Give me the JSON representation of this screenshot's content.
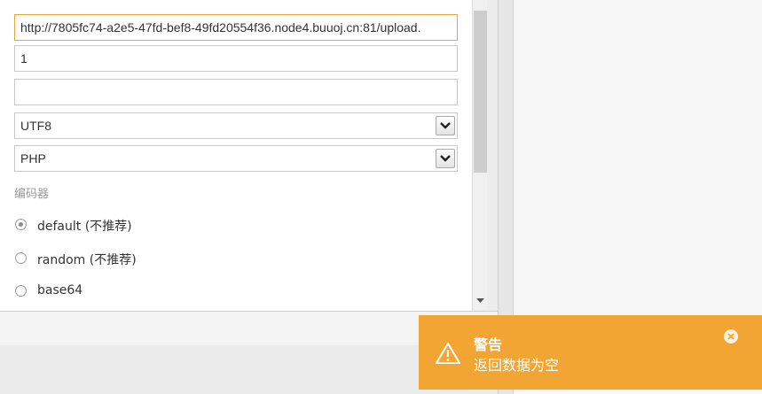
{
  "form": {
    "url_value": "http://7805fc74-a2e5-47fd-bef8-49fd20554f36.node4.buuoj.cn:81/upload.",
    "password_value": "1",
    "note_value": "",
    "encoding_selected": "UTF8",
    "type_selected": "PHP"
  },
  "encoder": {
    "label": "编码器",
    "options": [
      {
        "label": "default (不推荐)",
        "checked": true
      },
      {
        "label": "random (不推荐)",
        "checked": false
      },
      {
        "label": "base64",
        "checked": false
      }
    ]
  },
  "toast": {
    "title": "警告",
    "message": "返回数据为空",
    "color": "#f3a533"
  },
  "icons": [
    "chevron-down-icon",
    "chevron-up-icon",
    "warning-icon",
    "close-icon"
  ]
}
